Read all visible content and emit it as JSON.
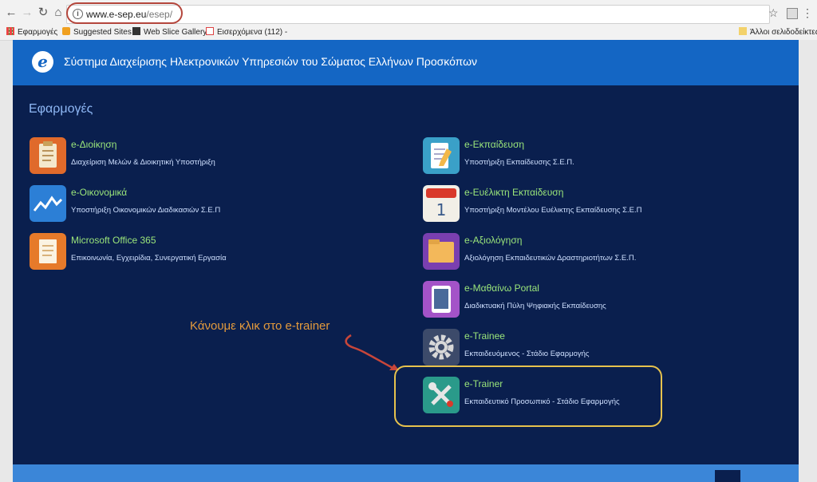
{
  "browser": {
    "url_host": "www.e-sep.eu",
    "url_path": "/esep/",
    "bookmarks": [
      "Εφαρμογές",
      "Suggested Sites",
      "Web Slice Gallery",
      "Εισερχόμενα (112) - "
    ],
    "other_bookmarks": "Άλλοι σελιδοδείκτες"
  },
  "header": {
    "title": "Σύστημα Διαχείρισης Ηλεκτρονικών Υπηρεσιών του Σώματος Ελλήνων Προσκόπων"
  },
  "section_title": "Εφαρμογές",
  "apps_left": [
    {
      "name": "e-Διοίκηση",
      "desc": "Διαχείριση Μελών & Διοικητική Υποστήριξη"
    },
    {
      "name": "e-Οικονομικά",
      "desc": "Υποστήριξη Οικονομικών Διαδικασιών Σ.Ε.Π"
    },
    {
      "name": "Microsoft Office 365",
      "desc": "Επικοινωνία, Εγχειρίδια, Συνεργατική Εργασία"
    }
  ],
  "apps_right": [
    {
      "name": "e-Εκπαίδευση",
      "desc": "Υποστήριξη Εκπαίδευσης Σ.Ε.Π."
    },
    {
      "name": "e-Ευέλικτη Εκπαίδευση",
      "desc": "Υποστήριξη Μοντέλου Ευέλικτης Εκπαίδευσης Σ.Ε.Π"
    },
    {
      "name": "e-Αξιολόγηση",
      "desc": "Αξιολόγηση Εκπαιδευτικών Δραστηριοτήτων Σ.Ε.Π."
    },
    {
      "name": "e-Μαθαίνω Portal",
      "desc": "Διαδικτυακή Πύλη Ψηφιακής Εκπαίδευσης"
    },
    {
      "name": "e-Trainee",
      "desc": "Εκπαιδευόμενος - Στάδιο Εφαρμογής"
    },
    {
      "name": "e-Trainer",
      "desc": "Εκπαιδευτικό Προσωπικό - Στάδιο Εφαρμογής"
    }
  ],
  "annotation": "Κάνουμε κλικ στο e-trainer",
  "colors": {
    "header": "#1466c4",
    "page_bg": "#0a1f4e",
    "app_name": "#9be67a",
    "annotation": "#e39a3c",
    "highlight": "#e7c24d"
  }
}
